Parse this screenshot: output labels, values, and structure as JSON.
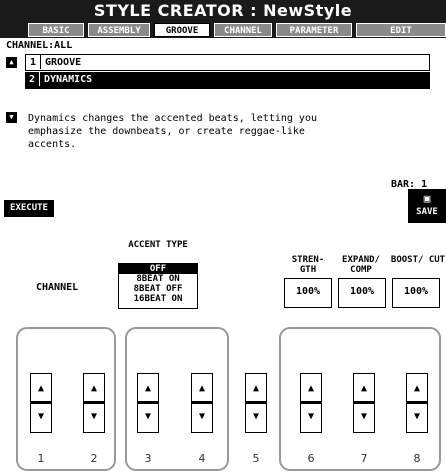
{
  "screen": {
    "title": "STYLE CREATOR : NewStyle",
    "tabs": [
      {
        "label": "BASIC",
        "active": false
      },
      {
        "label": "ASSEMBLY",
        "active": false
      },
      {
        "label": "GROOVE",
        "active": true
      },
      {
        "label": "CHANNEL",
        "active": false
      },
      {
        "label": "PARAMETER",
        "active": false
      },
      {
        "label": "EDIT",
        "active": false
      }
    ],
    "channel_label": "CHANNEL:ALL",
    "list": [
      {
        "num": "1",
        "label": "GROOVE",
        "selected": false
      },
      {
        "num": "2",
        "label": "DYNAMICS",
        "selected": true
      }
    ],
    "description": "Dynamics changes the accented beats, letting you emphasize the downbeats, or create reggae-like accents.",
    "bar_label": "BAR:  1",
    "execute_label": "EXECUTE",
    "save_label": "SAVE",
    "accent": {
      "head": "ACCENT TYPE",
      "options": [
        "OFF",
        "8BEAT ON",
        "8BEAT OFF",
        "16BEAT ON"
      ],
      "selected": "OFF"
    },
    "channel_param_label": "CHANNEL",
    "params": [
      {
        "head": "STREN- GTH",
        "value": "100%"
      },
      {
        "head": "EXPAND/ COMP",
        "value": "100%"
      },
      {
        "head": "BOOST/ CUT",
        "value": "100%"
      }
    ],
    "selector_arrows": "▲▼"
  },
  "hardware": {
    "buttons": [
      "1",
      "2",
      "3",
      "4",
      "5",
      "6",
      "7",
      "8"
    ],
    "up_glyph": "▲",
    "down_glyph": "▼"
  },
  "colors": {
    "lcd_dark": "#1a1a1a",
    "inactive_tab": "#8a8a8a",
    "group_outline": "#999999"
  }
}
